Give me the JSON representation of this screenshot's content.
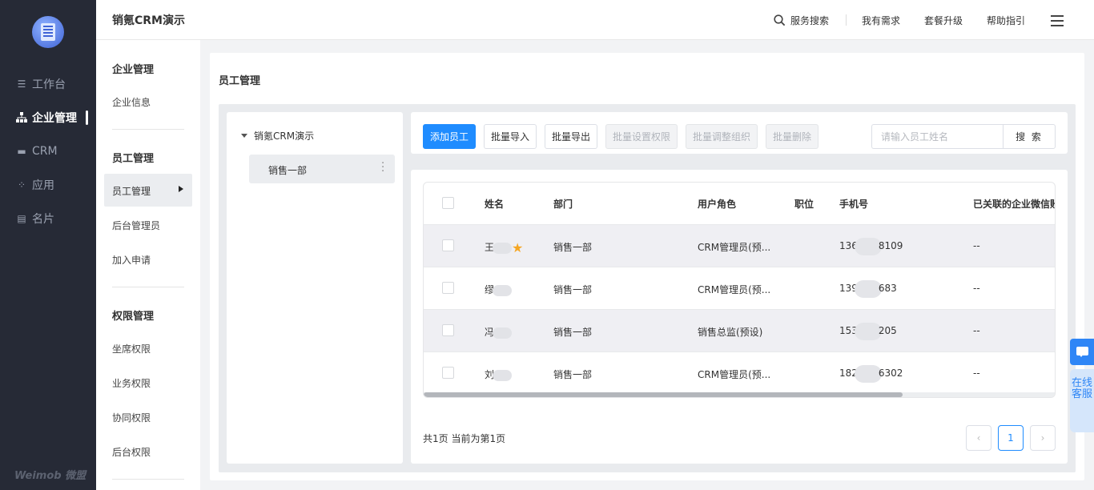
{
  "nav": {
    "items": [
      {
        "label": "工作台",
        "icon": "workbench-icon"
      },
      {
        "label": "企业管理",
        "icon": "org-chart-icon"
      },
      {
        "label": "CRM",
        "icon": "crm-icon"
      },
      {
        "label": "应用",
        "icon": "apps-icon"
      },
      {
        "label": "名片",
        "icon": "card-icon"
      }
    ],
    "brand": "Weimob 微盟"
  },
  "header": {
    "title": "销氪CRM演示",
    "links": [
      "服务搜索",
      "我有需求",
      "套餐升级",
      "帮助指引"
    ]
  },
  "sub": {
    "sections": [
      {
        "title": "企业管理",
        "items": [
          "企业信息"
        ]
      },
      {
        "title": "员工管理",
        "items": [
          "员工管理",
          "后台管理员",
          "加入申请"
        ]
      },
      {
        "title": "权限管理",
        "items": [
          "坐席权限",
          "业务权限",
          "协同权限",
          "后台权限"
        ]
      }
    ]
  },
  "page": {
    "title": "员工管理",
    "tree": {
      "root": "销氪CRM演示",
      "node": "销售一部"
    },
    "toolbar": {
      "add": "添加员工",
      "import": "批量导入",
      "export": "批量导出",
      "perm": "批量设置权限",
      "org": "批量调整组织",
      "del": "批量删除",
      "search_placeholder": "请输入员工姓名",
      "search": "搜 索"
    },
    "columns": [
      "姓名",
      "部门",
      "用户角色",
      "职位",
      "手机号",
      "已关联的企业微信账"
    ],
    "rows": [
      {
        "name": "王",
        "name_tail": "",
        "dept": "销售一部",
        "role": "CRM管理员(预...",
        "phone_head": "136",
        "phone_tail": "8109",
        "wx": "--"
      },
      {
        "name": "缪",
        "name_tail": "",
        "dept": "销售一部",
        "role": "CRM管理员(预...",
        "phone_head": "139",
        "phone_tail": "683",
        "wx": "--"
      },
      {
        "name": "冯",
        "name_tail": "",
        "dept": "销售一部",
        "role": "销售总监(预设)",
        "phone_head": "153",
        "phone_tail": "205",
        "wx": "--"
      },
      {
        "name": "刘",
        "name_tail": "",
        "dept": "销售一部",
        "role": "CRM管理员(预...",
        "phone_head": "182",
        "phone_tail": "6302",
        "wx": "--"
      }
    ],
    "pageinfo": "共1页 当前为第1页",
    "current_page": "1"
  },
  "float": {
    "service": "在线客服"
  }
}
